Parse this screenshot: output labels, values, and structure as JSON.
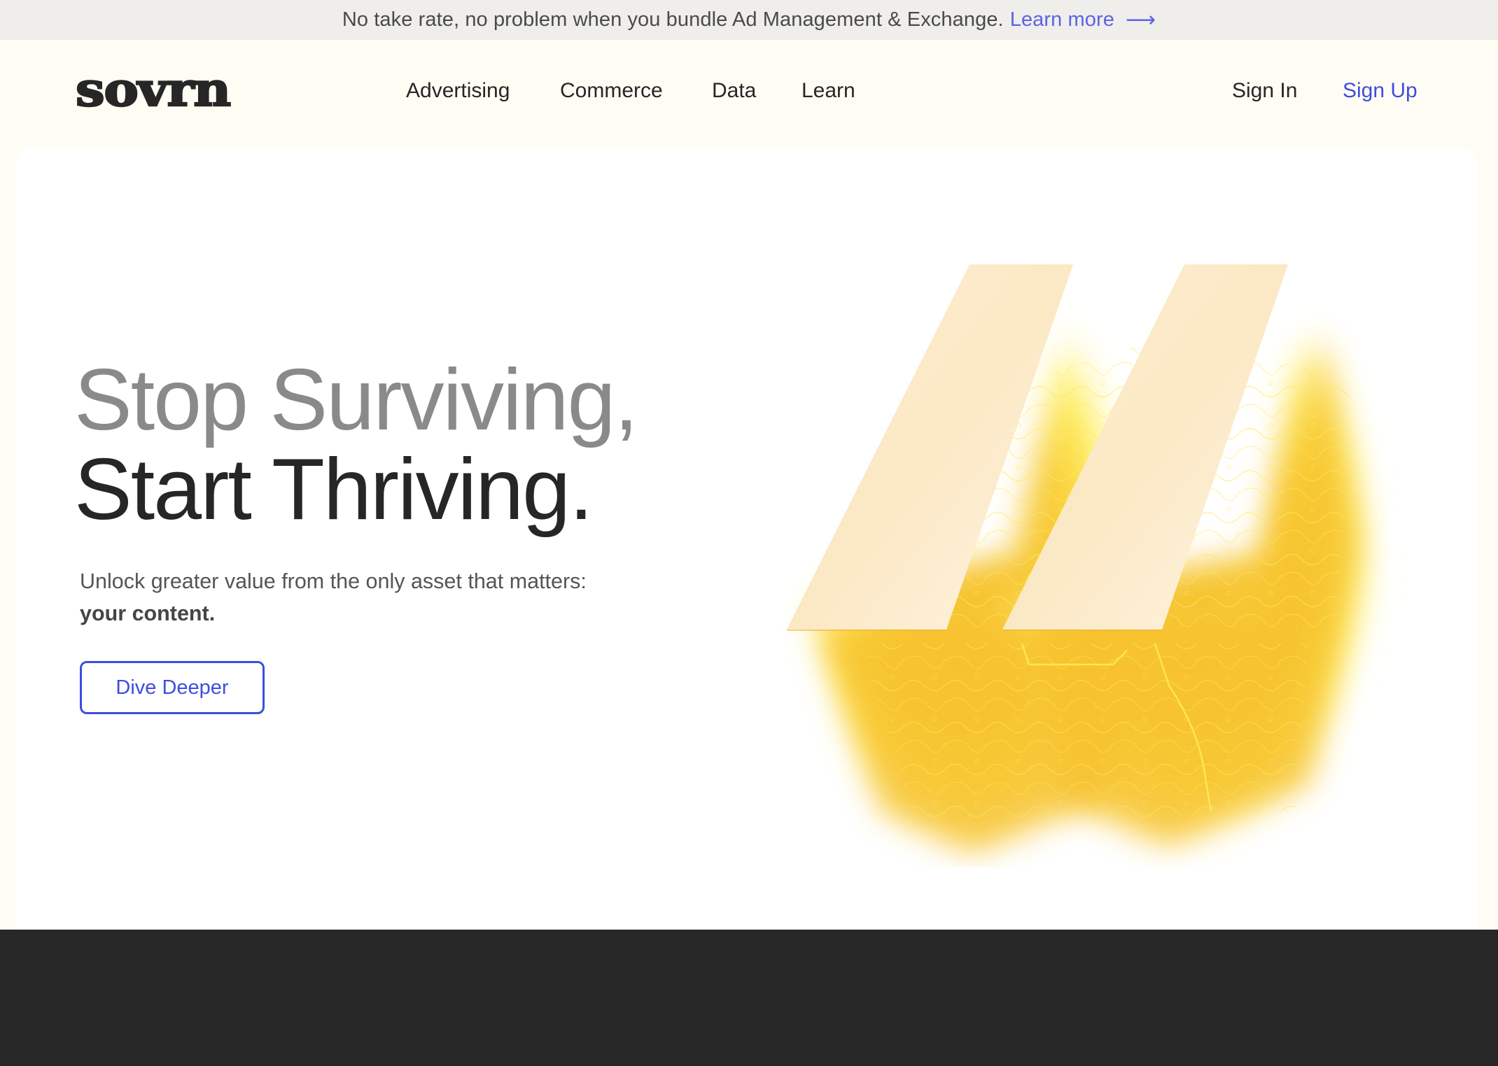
{
  "announcement": {
    "text": "No take rate, no problem when you bundle Ad Management & Exchange.",
    "link_label": "Learn more",
    "arrow_icon": "arrow-right-icon",
    "arrow_glyph": "⟶"
  },
  "header": {
    "logo": "sovrn",
    "nav": [
      {
        "label": "Advertising"
      },
      {
        "label": "Commerce"
      },
      {
        "label": "Data"
      },
      {
        "label": "Learn"
      }
    ],
    "sign_in": "Sign In",
    "sign_up": "Sign Up"
  },
  "hero": {
    "title_line1": "Stop Surviving,",
    "title_line2": "Start Thriving.",
    "subtitle": "Unlock greater value from the only asset that matters:",
    "subtitle_bold": "your content.",
    "cta_label": "Dive Deeper",
    "graphic": "sovrn-double-slash-glow-graphic"
  },
  "colors": {
    "accent": "#3d4ee0",
    "announcement_link": "#5b63e6",
    "page_bg": "#fffcf3",
    "announcement_bg": "#efeeea",
    "title_muted": "#8a8a8a",
    "title_dark": "#262626",
    "glow_yellow": "#f7c531",
    "footer_bg": "#272727"
  }
}
